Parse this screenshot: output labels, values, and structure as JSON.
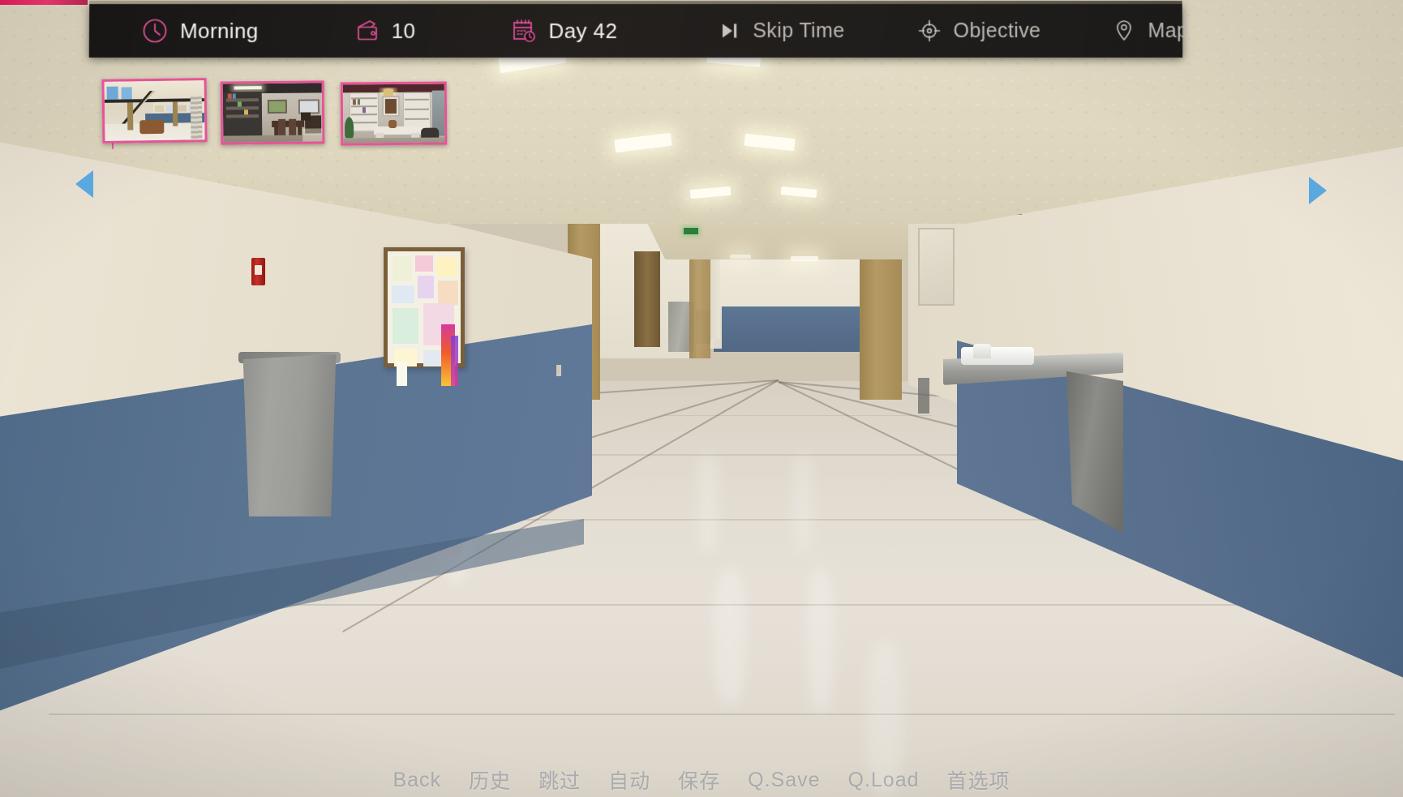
{
  "scene": {
    "title": "School Hallway",
    "description": "First-person 3D view of a school corridor with blue wainscoting, glossy tile floor, bulletin board, trash can and water fountain"
  },
  "hud": {
    "items": [
      {
        "id": "time-of-day",
        "icon": "clock-icon",
        "label": "Morning",
        "accent": "#e8529a",
        "style": "accent"
      },
      {
        "id": "money",
        "icon": "wallet-icon",
        "label": "10",
        "accent": "#e8529a",
        "style": "accent"
      },
      {
        "id": "day-counter",
        "icon": "calendar-icon",
        "label": "Day 42",
        "accent": "#e8529a",
        "style": "accent"
      },
      {
        "id": "skip-time",
        "icon": "skip-icon",
        "label": "Skip Time",
        "accent": "#c9c4bf",
        "style": "dim"
      },
      {
        "id": "objective",
        "icon": "target-icon",
        "label": "Objective",
        "accent": "#c9c4bf",
        "style": "dim"
      },
      {
        "id": "map",
        "icon": "map-pin-icon",
        "label": "Map",
        "accent": "#c9c4bf",
        "style": "dim"
      }
    ],
    "accent_color": "#e8529a",
    "dim_color": "#bdb8b3",
    "background_color": "#141211"
  },
  "location_strip": {
    "prev_arrow_label": "Previous locations",
    "next_arrow_label": "Next locations",
    "arrow_color": "#5aa8e0",
    "border_color": "#e8529a",
    "thumbnails": [
      {
        "id": "thumb-1",
        "name": "School Atrium",
        "selected": true
      },
      {
        "id": "thumb-2",
        "name": "Dining Room",
        "selected": false
      },
      {
        "id": "thumb-3",
        "name": "Study Library",
        "selected": false
      }
    ]
  },
  "bottom_menu": {
    "text_color": "#787e8c",
    "items": [
      {
        "id": "back",
        "label": "Back"
      },
      {
        "id": "history",
        "label": "历史"
      },
      {
        "id": "skip",
        "label": "跳过"
      },
      {
        "id": "auto",
        "label": "自动"
      },
      {
        "id": "save",
        "label": "保存"
      },
      {
        "id": "qsave",
        "label": "Q.Save"
      },
      {
        "id": "qload",
        "label": "Q.Load"
      },
      {
        "id": "prefs",
        "label": "首选项"
      }
    ]
  }
}
